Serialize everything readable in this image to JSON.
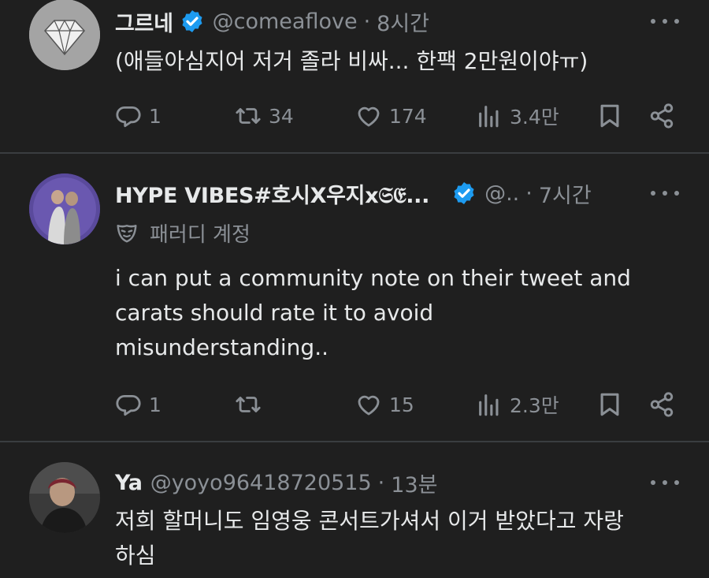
{
  "tweets": [
    {
      "name": "그르네",
      "handle": "@comeaflove",
      "dot": "·",
      "time": "8시간",
      "text": "(애들아심지어 저거 졸라 비싸... 한팩 2만원이야ㅠ)",
      "replies": "1",
      "retweets": "34",
      "likes": "174",
      "views": "3.4만"
    },
    {
      "name": "HYPE VIBES#호시X우지x𝔖𝔈...",
      "handle": "@..",
      "dot": "·",
      "time": "7시간",
      "parody_label": "패러디 계정",
      "text_lines": [
        "i can put a community note on their tweet and",
        "carats should rate it to avoid",
        "misunderstanding.."
      ],
      "replies": "1",
      "retweets": "",
      "likes": "15",
      "views": "2.3만"
    },
    {
      "name": "Ya",
      "handle": "@yoyo96418720515",
      "dot": "·",
      "time": "13분",
      "text_lines": [
        "저희 할머니도 임영웅 콘서트가셔서 이거 받았다고 자랑",
        "하심"
      ]
    }
  ],
  "icons": {
    "reply": "reply-icon",
    "retweet": "retweet-icon",
    "like": "heart-icon",
    "views": "views-icon",
    "bookmark": "bookmark-icon",
    "share": "share-icon",
    "verified": "verified-badge-icon",
    "parody": "parody-mask-icon",
    "more": "more-icon"
  },
  "colors": {
    "background": "#1f1f1f",
    "text": "#e7e9ea",
    "muted": "#8b9096",
    "verified": "#1d9bf0",
    "divider": "#3a3d40"
  }
}
